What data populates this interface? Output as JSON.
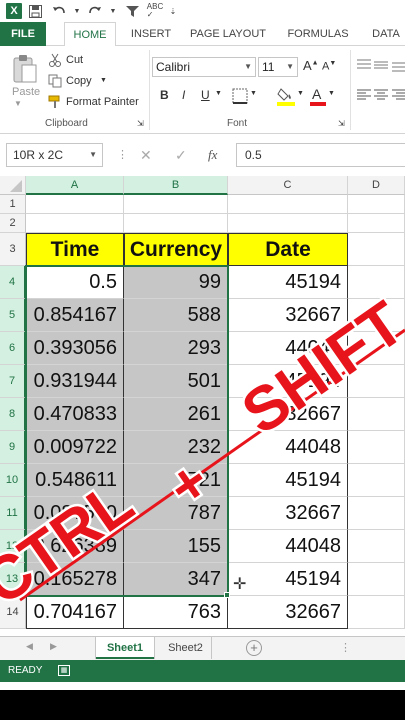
{
  "quick_access": {
    "icons": [
      "excel-logo-icon",
      "save-icon",
      "undo-icon",
      "redo-icon",
      "filter-icon",
      "spelling-icon",
      "customize-icon"
    ],
    "app_logo": "X"
  },
  "tabs": [
    {
      "label": "FILE"
    },
    {
      "label": "HOME"
    },
    {
      "label": "INSERT"
    },
    {
      "label": "PAGE LAYOUT"
    },
    {
      "label": "FORMULAS"
    },
    {
      "label": "DATA"
    }
  ],
  "clipboard": {
    "paste": "Paste",
    "cut": "Cut",
    "copy": "Copy",
    "format_painter": "Format Painter",
    "label": "Clipboard"
  },
  "font": {
    "name": "Calibri",
    "size": "11",
    "bold": "B",
    "italic": "I",
    "underline": "U",
    "grow": "A",
    "shrink": "A",
    "label": "Font"
  },
  "formula_bar": {
    "name_box": "10R x 2C",
    "cancel": "✕",
    "enter": "✓",
    "fx": "fx",
    "value": "0.5"
  },
  "columns": [
    "A",
    "B",
    "C",
    "D"
  ],
  "rows": [
    "1",
    "2",
    "3",
    "4",
    "5",
    "6",
    "7",
    "8",
    "9",
    "10",
    "11",
    "12",
    "13",
    "14"
  ],
  "table": {
    "headers": [
      "Time",
      "Currency",
      "Date"
    ],
    "data": [
      [
        "0.5",
        "99",
        "45194"
      ],
      [
        "0.854167",
        "588",
        "32667"
      ],
      [
        "0.393056",
        "293",
        "44048"
      ],
      [
        "0.931944",
        "501",
        "45194"
      ],
      [
        "0.470833",
        "261",
        "32667"
      ],
      [
        "0.009722",
        "232",
        "44048"
      ],
      [
        "0.548611",
        "721",
        "45194"
      ],
      [
        "0.087500",
        "787",
        "32667"
      ],
      [
        "0.626389",
        "155",
        "44048"
      ],
      [
        "0.165278",
        "347",
        "45194"
      ],
      [
        "0.704167",
        "763",
        "32667"
      ]
    ]
  },
  "sheets": [
    "Sheet1",
    "Sheet2"
  ],
  "status": {
    "mode": "READY"
  },
  "overlay": {
    "left_text": "CTRL",
    "plus": "+",
    "right_text": "SHIFT",
    "color": "#e8141b"
  },
  "colors": {
    "accent": "#217346",
    "header_fill": "#ffff00",
    "selection_fill": "#c6c6c6"
  }
}
